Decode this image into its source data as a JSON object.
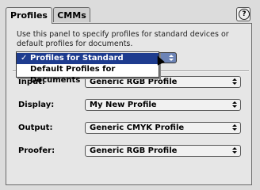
{
  "tabs": [
    {
      "label": "Profiles"
    },
    {
      "label": "CMMs"
    }
  ],
  "help": {
    "icon": "help-icon",
    "label": "?"
  },
  "description": "Use this panel to specify profiles for standard devices or default profiles for documents.",
  "mode_menu": {
    "items": [
      {
        "label": "Profiles for Standard Devices",
        "checked": true
      },
      {
        "label": "Default Profiles for Documents",
        "checked": false
      }
    ],
    "check_mark": "✓"
  },
  "settings": [
    {
      "label": "Input:",
      "value": "Generic RGB Profile"
    },
    {
      "label": "Display:",
      "value": "My New Profile"
    },
    {
      "label": "Output:",
      "value": "Generic CMYK Profile"
    },
    {
      "label": "Proofer:",
      "value": "Generic RGB Profile"
    }
  ],
  "colors": {
    "menu_highlight": "#1e3c8f",
    "panel": "#e6e6e6"
  }
}
